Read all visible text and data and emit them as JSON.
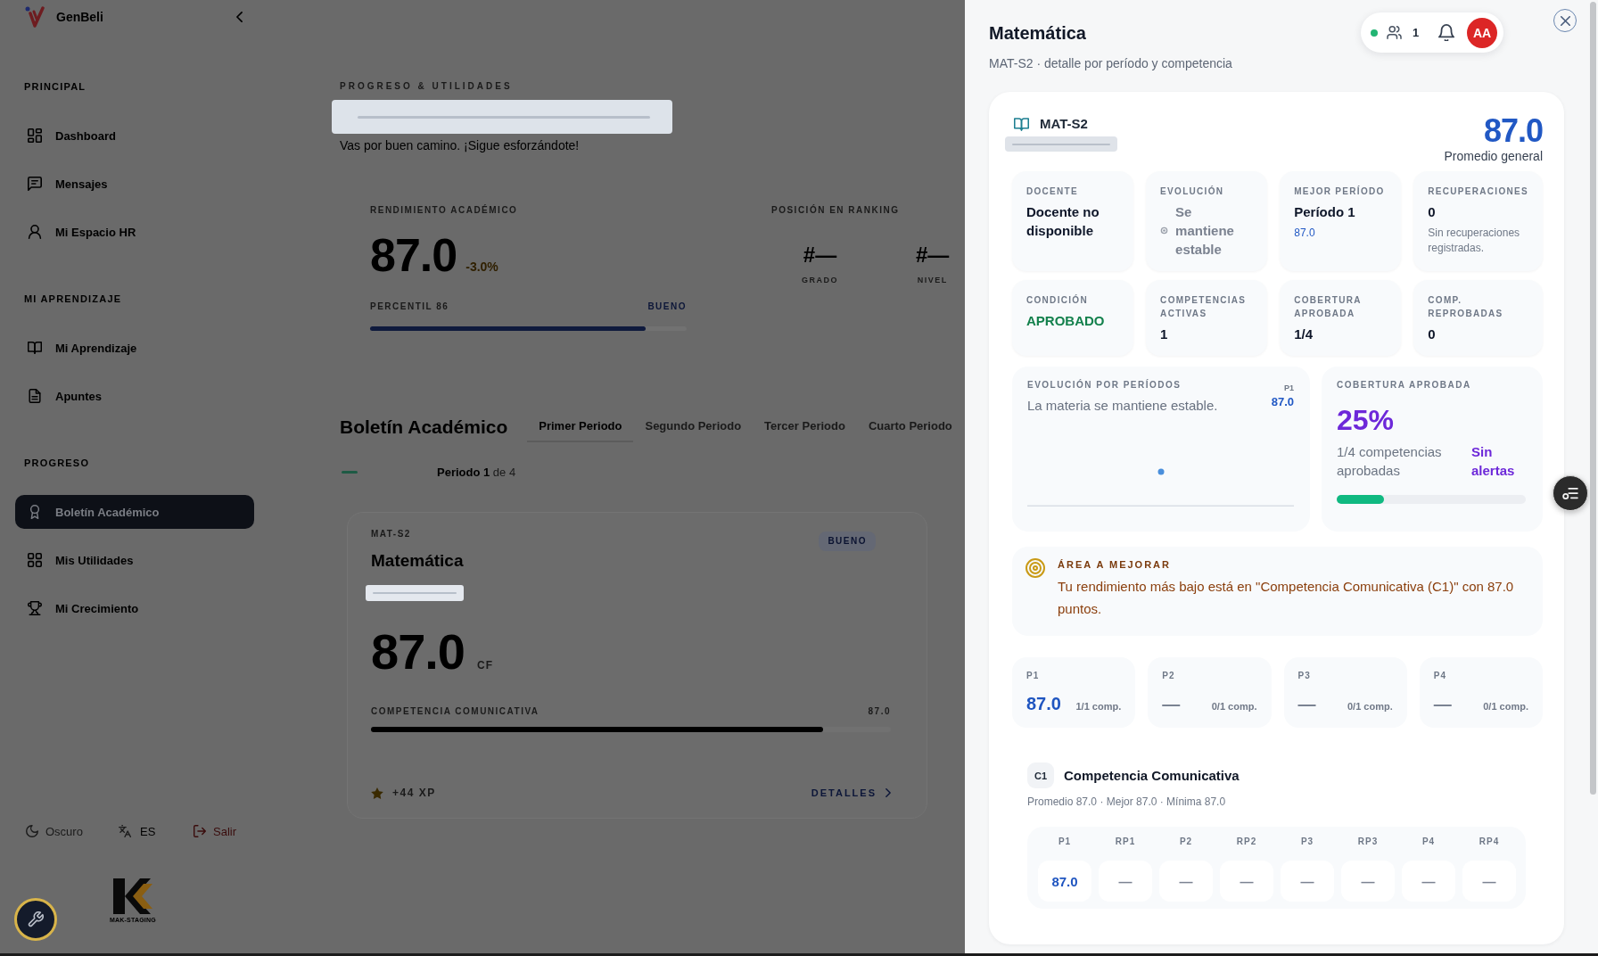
{
  "sidebar": {
    "brand": "GenBeli",
    "sections": [
      {
        "title": "PRINCIPAL",
        "items": [
          {
            "label": "Dashboard",
            "selected": false
          },
          {
            "label": "Mensajes",
            "selected": false
          },
          {
            "label": "Mi Espacio HR",
            "selected": false
          }
        ]
      },
      {
        "title": "MI APRENDIZAJE",
        "items": [
          {
            "label": "Mi Aprendizaje",
            "selected": false
          },
          {
            "label": "Apuntes",
            "selected": false
          }
        ]
      },
      {
        "title": "PROGRESO",
        "items": [
          {
            "label": "Boletín Académico",
            "selected": true
          },
          {
            "label": "Mis Utilidades",
            "selected": false
          },
          {
            "label": "Mi Crecimiento",
            "selected": false
          }
        ]
      }
    ],
    "footer": [
      {
        "kind": "theme",
        "label": "Oscuro"
      },
      {
        "kind": "language",
        "label": "ES"
      },
      {
        "kind": "logout",
        "label": "Salir"
      }
    ],
    "environment": "MAK-STAGING"
  },
  "main": {
    "section_label": "PROGRESO & UTILIDADES",
    "message": "Vas por buen camino. ¡Sigue esforzándote!",
    "performance": {
      "label": "RENDIMIENTO ACADÉMICO",
      "score": "87.0",
      "change": "-3.0%",
      "percentile": "PERCENTIL 86",
      "rating": "BUENO",
      "level": 0.87
    },
    "ranking": {
      "label": "POSICIÓN EN RANKING",
      "items": [
        {
          "value": "#—",
          "label": "GRADO"
        },
        {
          "value": "#—",
          "label": "NIVEL"
        }
      ]
    },
    "report": {
      "title": "Boletín Académico",
      "tabs": [
        {
          "label": "Primer Periodo",
          "selected": true
        },
        {
          "label": "Segundo Periodo",
          "selected": false
        },
        {
          "label": "Tercer Periodo",
          "selected": false
        },
        {
          "label": "Cuarto Periodo",
          "selected": false
        }
      ],
      "period": "**Periodo 1** de 4",
      "subject": {
        "code": "MAT-S2",
        "name": "Matemática",
        "rating": "BUENO",
        "score": "87.0",
        "score_unit": "CF",
        "competence": "COMPETENCIA COMUNICATIVA",
        "competence_score": "87.0",
        "level": 0.87,
        "xp": "+44 XP",
        "details": "DETALLES"
      }
    }
  },
  "drawer": {
    "title": "Matemática",
    "subtitle": "MAT-S2 · detalle por período y competencia",
    "presence": {
      "online": true,
      "count": "1",
      "avatar": "AA"
    },
    "subject": {
      "code": "MAT-S2",
      "average": "87.0",
      "average_label": "Promedio general",
      "stats": [
        {
          "kind": "plain",
          "label": "DOCENTE",
          "value": "Docente no disponible"
        },
        {
          "kind": "trend",
          "label": "EVOLUCIÓN",
          "value": "Se mantiene estable"
        },
        {
          "kind": "best",
          "label": "MEJOR PERÍODO",
          "value": "Período 1",
          "note": "87.0"
        },
        {
          "kind": "plain",
          "label": "RECUPERACIONES",
          "value": "0",
          "note": "Sin recuperaciones registradas."
        },
        {
          "kind": "status",
          "label": "CONDICIÓN",
          "value": "APROBADO"
        },
        {
          "kind": "plain",
          "label": "COMPETENCIAS ACTIVAS",
          "value": "1"
        },
        {
          "kind": "plain",
          "label": "COBERTURA APROBADA",
          "value": "1/4"
        },
        {
          "kind": "plain",
          "label": "COMP. REPROBADAS",
          "value": "0"
        }
      ],
      "evolution": {
        "title": "EVOLUCIÓN POR PERÍODOS",
        "text": "La materia se mantiene estable.",
        "point_label": "P1",
        "point_value": "87.0"
      },
      "coverage": {
        "title": "COBERTURA APROBADA",
        "percent": "25%",
        "text": "1/4 competencias aprobadas",
        "alerts": "Sin alertas",
        "level": 0.25
      },
      "improvement": {
        "title": "ÁREA A MEJORAR",
        "text": "Tu rendimiento más bajo está en \"Competencia Comunicativa (C1)\" con 87.0 puntos."
      },
      "periods": [
        {
          "kind": "graded",
          "label": "P1",
          "value": "87.0",
          "count": "1/1 comp."
        },
        {
          "kind": "empty",
          "label": "P2",
          "value": "—",
          "count": "0/1 comp."
        },
        {
          "kind": "empty",
          "label": "P3",
          "value": "—",
          "count": "0/1 comp."
        },
        {
          "kind": "empty",
          "label": "P4",
          "value": "—",
          "count": "0/1 comp."
        }
      ],
      "competences": [
        {
          "code": "C1",
          "name": "Competencia Comunicativa",
          "summary": "Promedio 87.0 · Mejor 87.0 · Mínima 87.0",
          "cells": [
            {
              "kind": "graded",
              "label": "P1",
              "value": "87.0"
            },
            {
              "kind": "empty",
              "label": "RP1",
              "value": "—"
            },
            {
              "kind": "empty",
              "label": "P2",
              "value": "—"
            },
            {
              "kind": "empty",
              "label": "RP2",
              "value": "—"
            },
            {
              "kind": "empty",
              "label": "P3",
              "value": "—"
            },
            {
              "kind": "empty",
              "label": "RP3",
              "value": "—"
            },
            {
              "kind": "empty",
              "label": "P4",
              "value": "—"
            },
            {
              "kind": "empty",
              "label": "RP4",
              "value": "—"
            }
          ]
        }
      ]
    }
  }
}
